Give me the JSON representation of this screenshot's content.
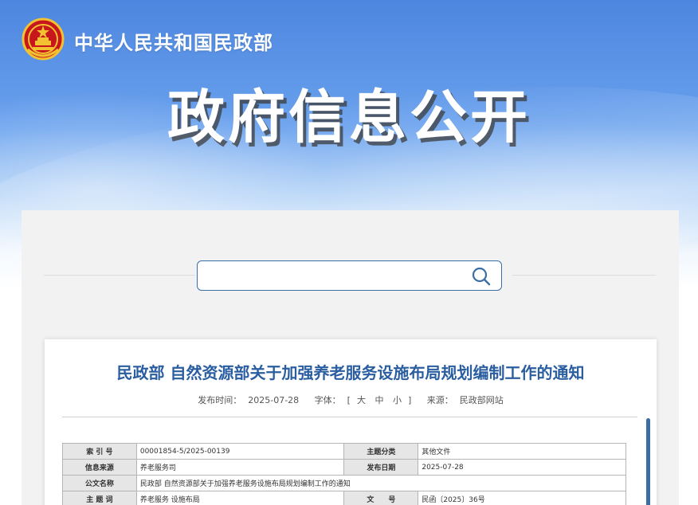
{
  "header": {
    "org_name": "中华人民共和国民政部",
    "banner_title": "政府信息公开"
  },
  "search": {
    "placeholder": ""
  },
  "article": {
    "title": "民政部 自然资源部关于加强养老服务设施布局规划编制工作的通知",
    "publish_label": "发布时间：",
    "publish_date": "2025-07-28",
    "font_label": "字体：",
    "font_open": "[",
    "font_large": "大",
    "font_medium": "中",
    "font_small": "小",
    "font_close": "]",
    "source_label": "来源：",
    "source": "民政部网站"
  },
  "info_table": {
    "rows": [
      {
        "k1": "索 引 号",
        "v1": "00001854-5/2025-00139",
        "k2": "主题分类",
        "v2": "其他文件"
      },
      {
        "k1": "信息来源",
        "v1": "养老服务司",
        "k2": "发布日期",
        "v2": "2025-07-28"
      },
      {
        "k1": "公文名称",
        "v1": "民政部 自然资源部关于加强养老服务设施布局规划编制工作的通知"
      },
      {
        "k1": "主 题 词",
        "v1": "养老服务 设施布局",
        "k2": "文　　号",
        "v2": "民函〔2025〕36号"
      }
    ]
  },
  "colors": {
    "accent": "#2a5ea0",
    "search_border": "#3a6ea5",
    "banner_top": "#4d86df"
  },
  "icons": {
    "emblem": "national-emblem",
    "search": "search-icon"
  }
}
